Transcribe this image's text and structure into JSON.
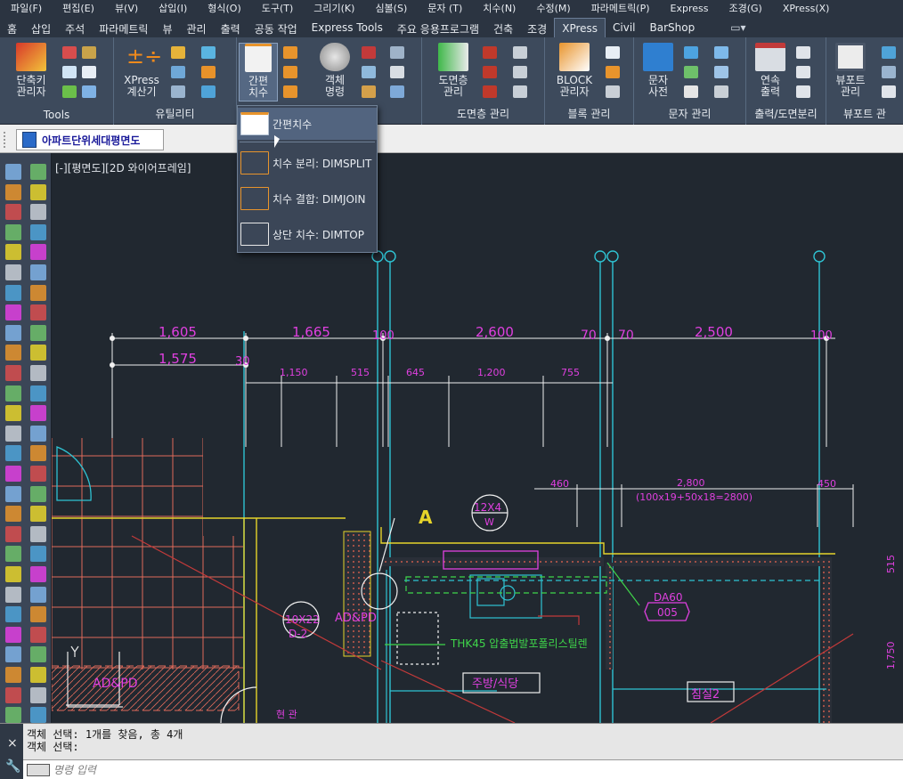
{
  "menu": [
    "파일(F)",
    "편집(E)",
    "뷰(V)",
    "삽입(I)",
    "형식(O)",
    "도구(T)",
    "그리기(K)",
    "심볼(S)",
    "문자 (T)",
    "치수(N)",
    "수정(M)",
    "파라메트릭(P)",
    "Express",
    "조경(G)",
    "XPress(X)"
  ],
  "tabs": [
    "홈",
    "삽입",
    "주석",
    "파라메트릭",
    "뷰",
    "관리",
    "출력",
    "공동 작업",
    "Express Tools",
    "주요 응용프로그램",
    "건축",
    "조경",
    "XPress",
    "Civil",
    "BarShop"
  ],
  "active_tab": "XPress",
  "ribbon": {
    "tools": {
      "title": "Tools",
      "btn": "단축키\n관리자"
    },
    "utility": {
      "title": "유틸리티",
      "btn": "XPress\n계산기"
    },
    "dim": {
      "btn": "간편\n치수"
    },
    "obj": {
      "btn": "객체\n명령"
    },
    "layer": {
      "title": "도면층 관리",
      "btn": "도면층\n관리"
    },
    "block": {
      "title": "블록 관리",
      "btn": "BLOCK\n관리자"
    },
    "text": {
      "title": "문자 관리",
      "btn": "문자\n사전"
    },
    "print": {
      "title": "출력/도면분리",
      "btn": "연속\n출력"
    },
    "viewport": {
      "title": "뷰포트 관",
      "btn": "뷰포트\n관리"
    }
  },
  "dropdown": [
    {
      "label": "간편치수"
    },
    {
      "label": "치수 분리: DIMSPLIT"
    },
    {
      "label": "치수 결합: DIMJOIN"
    },
    {
      "label": "상단 치수: DIMTOP"
    }
  ],
  "document_tab": "아파트단위세대평면도",
  "viewport_label": "[-][평면도][2D 와이어프레임]",
  "drawing": {
    "dims_row1": [
      "1,605",
      "1,665",
      "100",
      "2,600",
      "70",
      "70",
      "2,500",
      "100"
    ],
    "dims_row2": [
      "1,575",
      "30"
    ],
    "dims_row3": [
      "1,150",
      "515",
      "645",
      "1,200",
      "755"
    ],
    "dims_right": [
      "460",
      "2,800",
      "(100x19+50x18=2800)",
      "450"
    ],
    "label_a": "A",
    "window_tag": [
      "12X4",
      "W"
    ],
    "door_tag": [
      "10X22",
      "D-2"
    ],
    "material_note": "THK45 압출법발포폴리스틸렌",
    "room1": "주방/식당",
    "room2": "침실2",
    "hatch_label": "AD&PD",
    "hatch_label2": "AD&PD",
    "hex_tag": [
      "DA60",
      "005"
    ],
    "right_dims": [
      "515",
      "1,750"
    ],
    "door_small": "현 관"
  },
  "command": {
    "line1": "객체 선택: 1개를 찾음, 총 4개",
    "line2": "객체 선택:",
    "prompt": "명령 입력"
  }
}
